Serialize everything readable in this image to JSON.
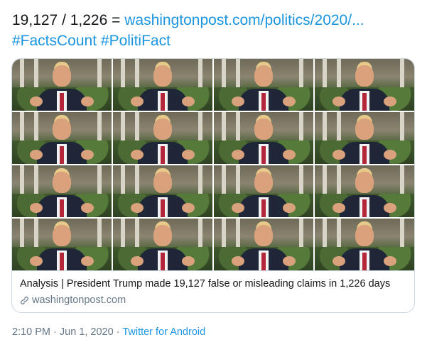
{
  "tweet": {
    "text_prefix": "19,127 / 1,226 = ",
    "link_text": "washingtonpost.com/politics/2020/...",
    "hashtag1": "#FactsCount",
    "hashtag2": "#PolitiFact"
  },
  "card": {
    "image_description": "grid of 16 repeated video stills",
    "title": "Analysis | President Trump made 19,127 false or misleading claims in 1,226 days",
    "domain": "washingtonpost.com",
    "domain_icon": "link-icon"
  },
  "meta": {
    "time": "2:10 PM",
    "separator1": " · ",
    "date": "Jun 1, 2020",
    "separator2": " · ",
    "source": "Twitter for Android"
  },
  "colors": {
    "link": "#1b95e0",
    "text": "#14171a",
    "muted": "#657786",
    "border": "#ccd6dd"
  }
}
